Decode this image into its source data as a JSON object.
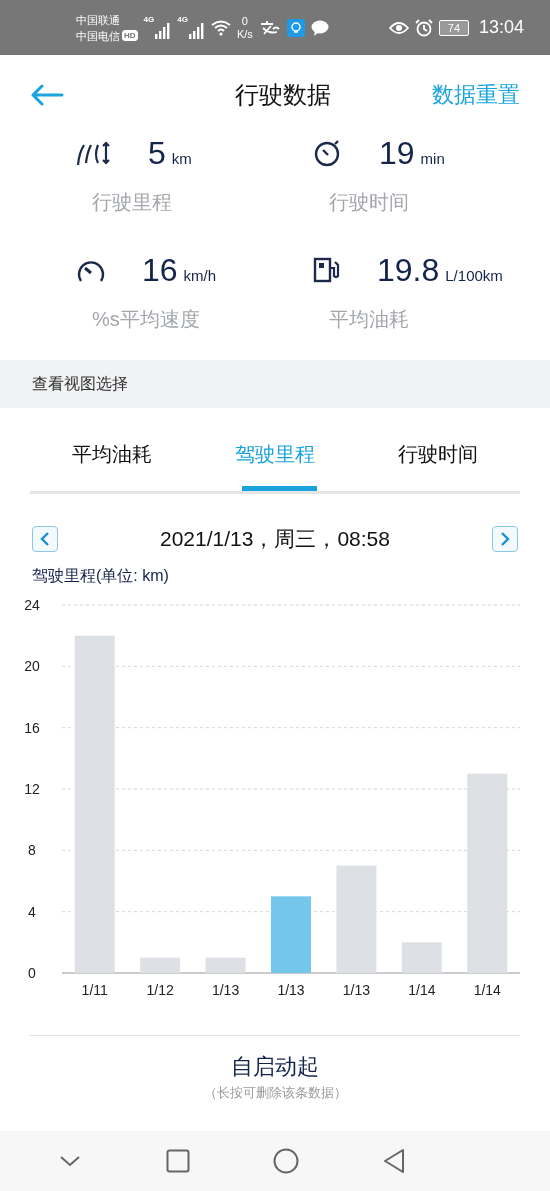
{
  "status_bar": {
    "carriers": [
      "中国联通",
      "中国电信"
    ],
    "hd": "HD",
    "networks": [
      "4G",
      "4G"
    ],
    "speed_value": "0",
    "speed_unit": "K/s",
    "battery": "74",
    "time": "13:04"
  },
  "header": {
    "title": "行驶数据",
    "action": "数据重置"
  },
  "stats": [
    {
      "kind": "road",
      "value": "5",
      "unit": "km",
      "label": "行驶里程"
    },
    {
      "kind": "stopwatch",
      "value": "19",
      "unit": "min",
      "label": "行驶时间"
    },
    {
      "kind": "gauge",
      "value": "16",
      "unit": "km/h",
      "label": "%s平均速度"
    },
    {
      "kind": "fuel",
      "value": "19.8",
      "unit": "L/100km",
      "label": "平均油耗"
    }
  ],
  "section_title": "查看视图选择",
  "tabs": [
    {
      "label": "平均油耗",
      "selected": false
    },
    {
      "label": "驾驶里程",
      "selected": true
    },
    {
      "label": "行驶时间",
      "selected": false
    }
  ],
  "date": "2021/1/13，周三，08:58",
  "chart": {
    "chart_data": {
      "type": "bar",
      "ylabel": "驾驶里程(单位: km)",
      "categories": [
        "1/11",
        "1/12",
        "1/13",
        "1/13",
        "1/13",
        "1/14",
        "1/14"
      ],
      "stacked": true,
      "grid": true,
      "series": [
        {
          "color": "#dde1e5",
          "values": [
            22,
            1,
            1,
            null,
            7,
            2,
            13
          ]
        },
        {
          "color": "#74c6ea",
          "values": [
            null,
            null,
            null,
            5,
            null,
            null,
            null
          ]
        }
      ],
      "ylim": [
        0,
        24
      ],
      "yticks": [
        0,
        4,
        8,
        12,
        16,
        20,
        24
      ]
    }
  },
  "footer": {
    "title": "自启动起",
    "hint": "（长按可删除该条数据）"
  }
}
